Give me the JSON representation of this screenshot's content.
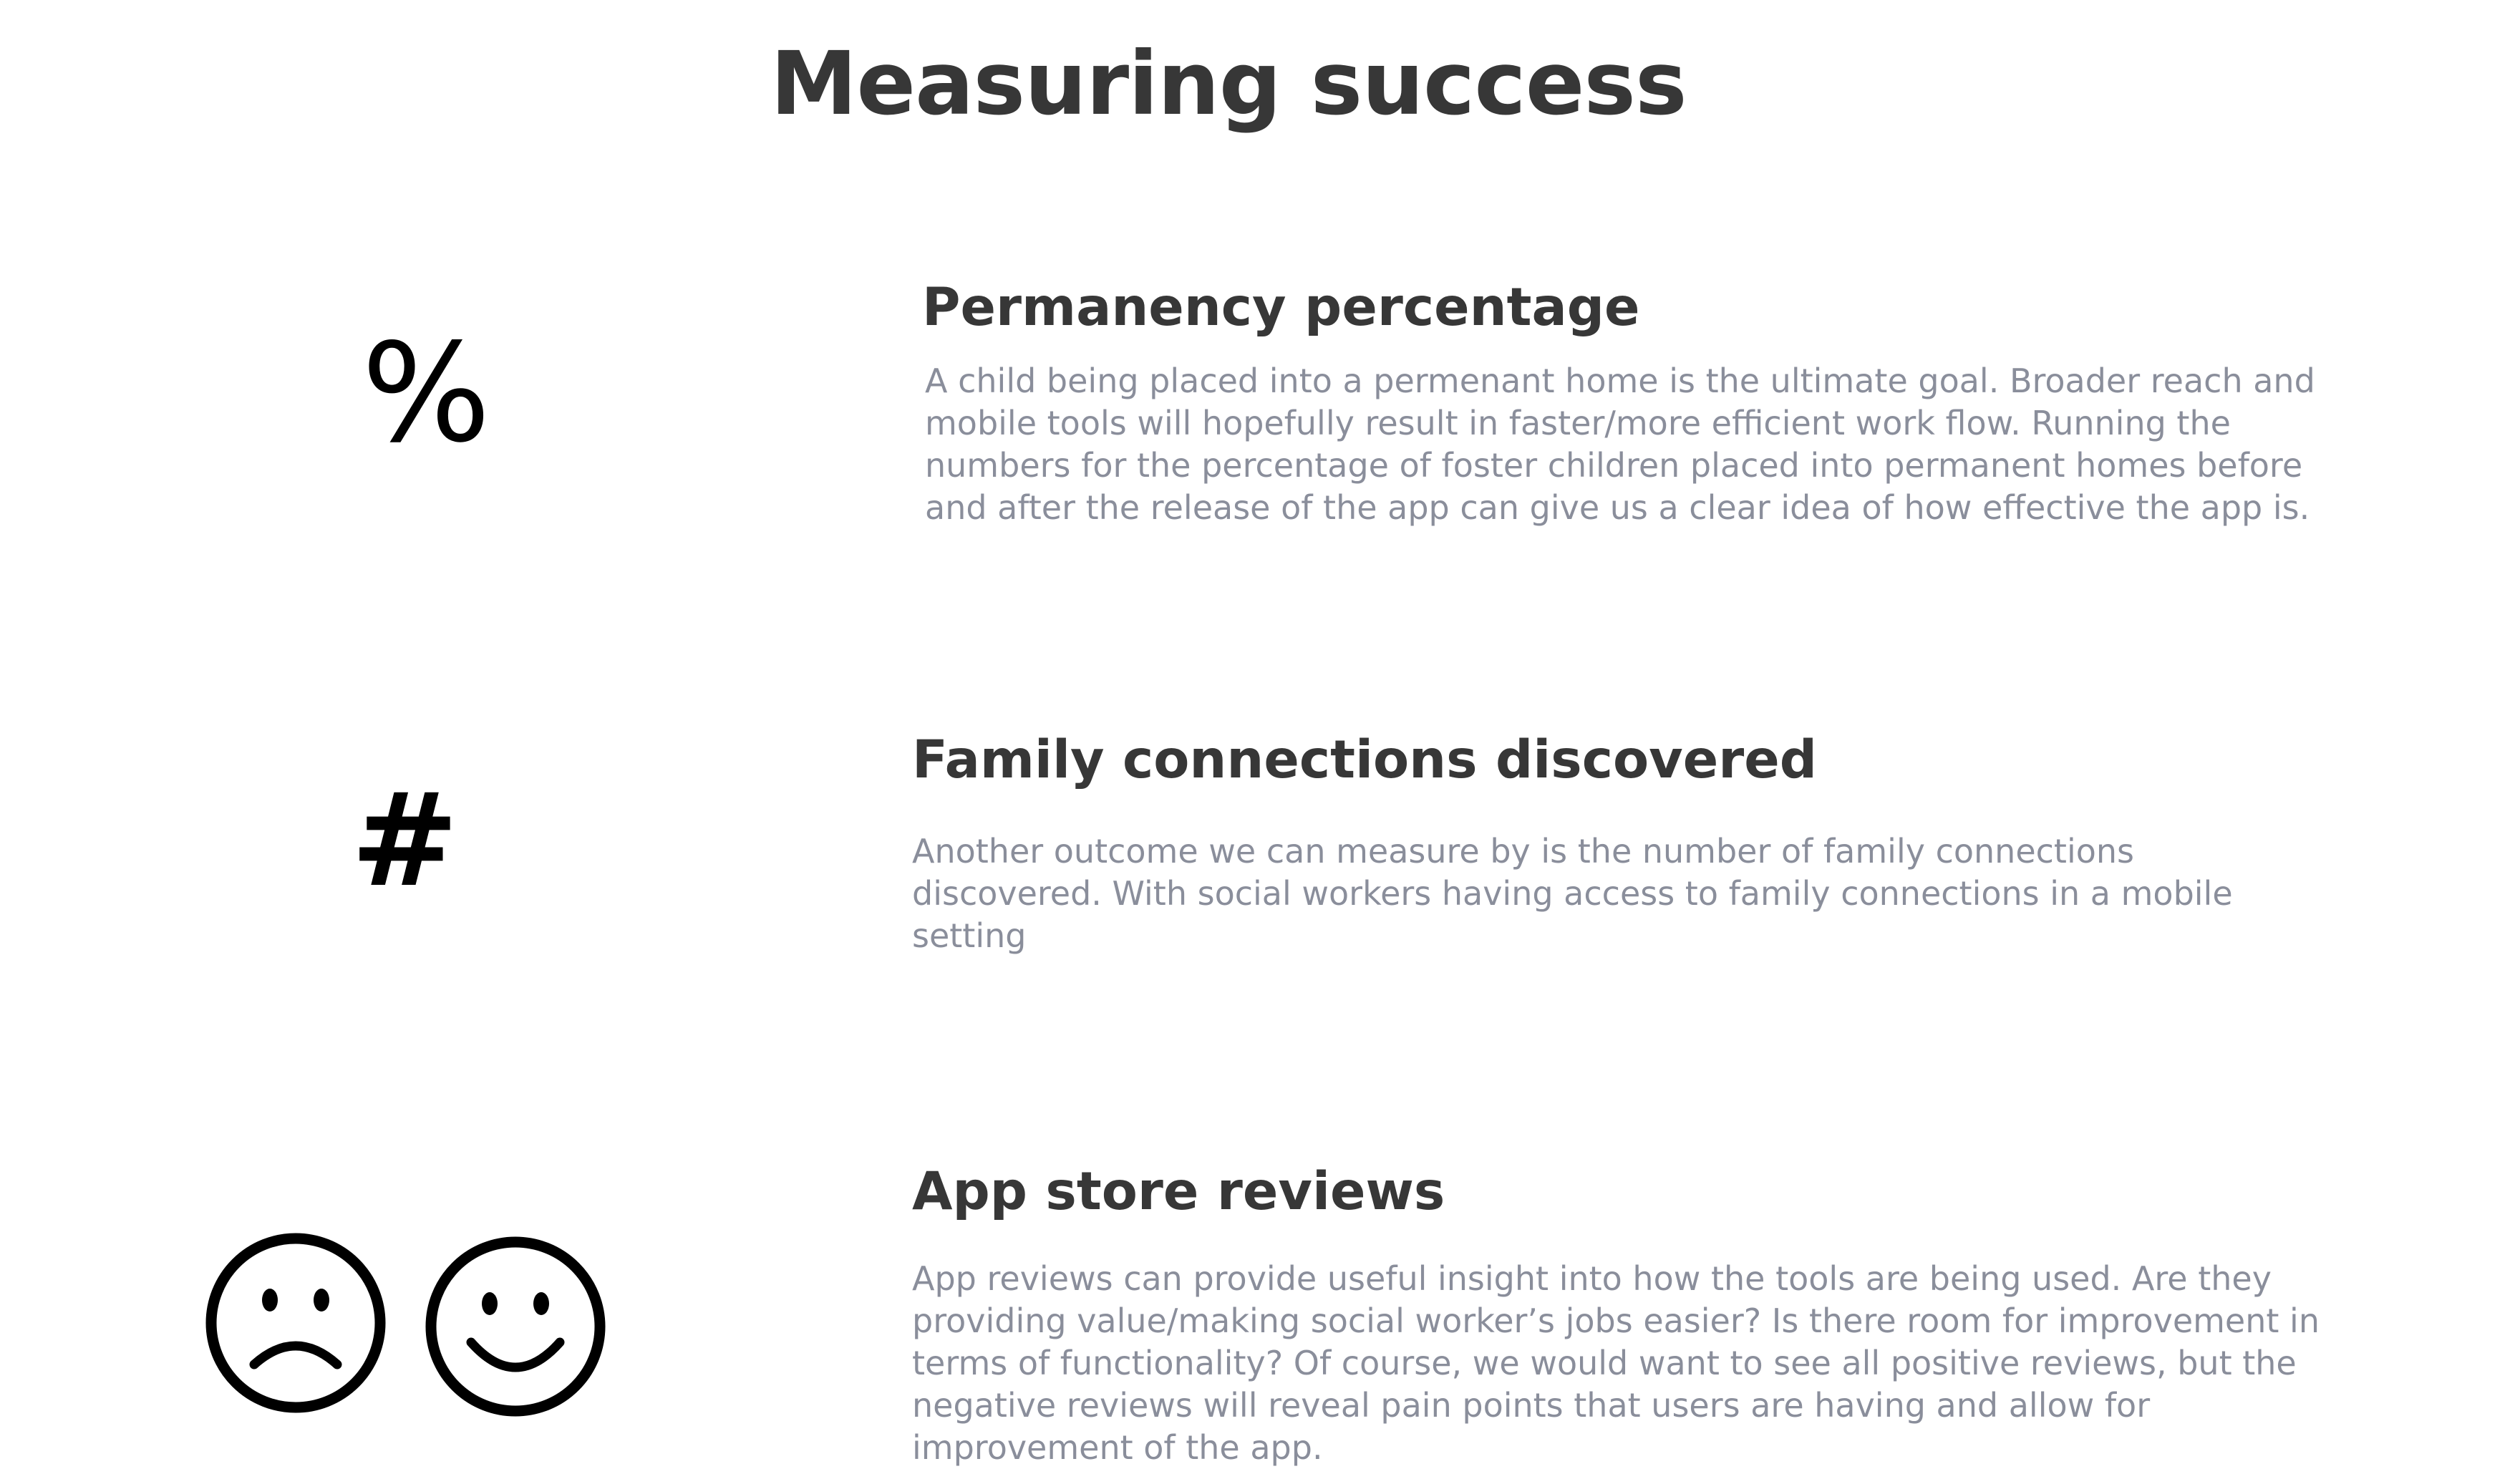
{
  "page": {
    "title": "Measuring success"
  },
  "sections": [
    {
      "icon": "percent-icon",
      "title": "Permanency percentage",
      "body": "A child being placed into a permenant home is the ultimate goal. Broader reach and mobile tools will hopefully result in faster/more efficient work flow. Running the numbers for the percentage of foster children placed into permanent homes before and after the release of the app can give us a clear idea of how effective the app is."
    },
    {
      "icon": "hash-icon",
      "title": "Family connections discovered",
      "body": "Another outcome we can measure by is the number of family connections discovered. With social workers having access to family connections in a mobile setting"
    },
    {
      "icon": "sad-and-happy-face-icons",
      "title": "App store reviews",
      "body": "App reviews can provide useful insight into how the tools are being used. Are they providing value/making social worker’s jobs easier? Is there room for improvement in terms of functionality? Of course, we would want to see all positive reviews, but the negative reviews will reveal pain points that users are having and allow for improvement of the app."
    }
  ],
  "colors": {
    "heading": "#373737",
    "body_text": "#8a8e9b",
    "icon": "#000000",
    "background": "#ffffff"
  }
}
